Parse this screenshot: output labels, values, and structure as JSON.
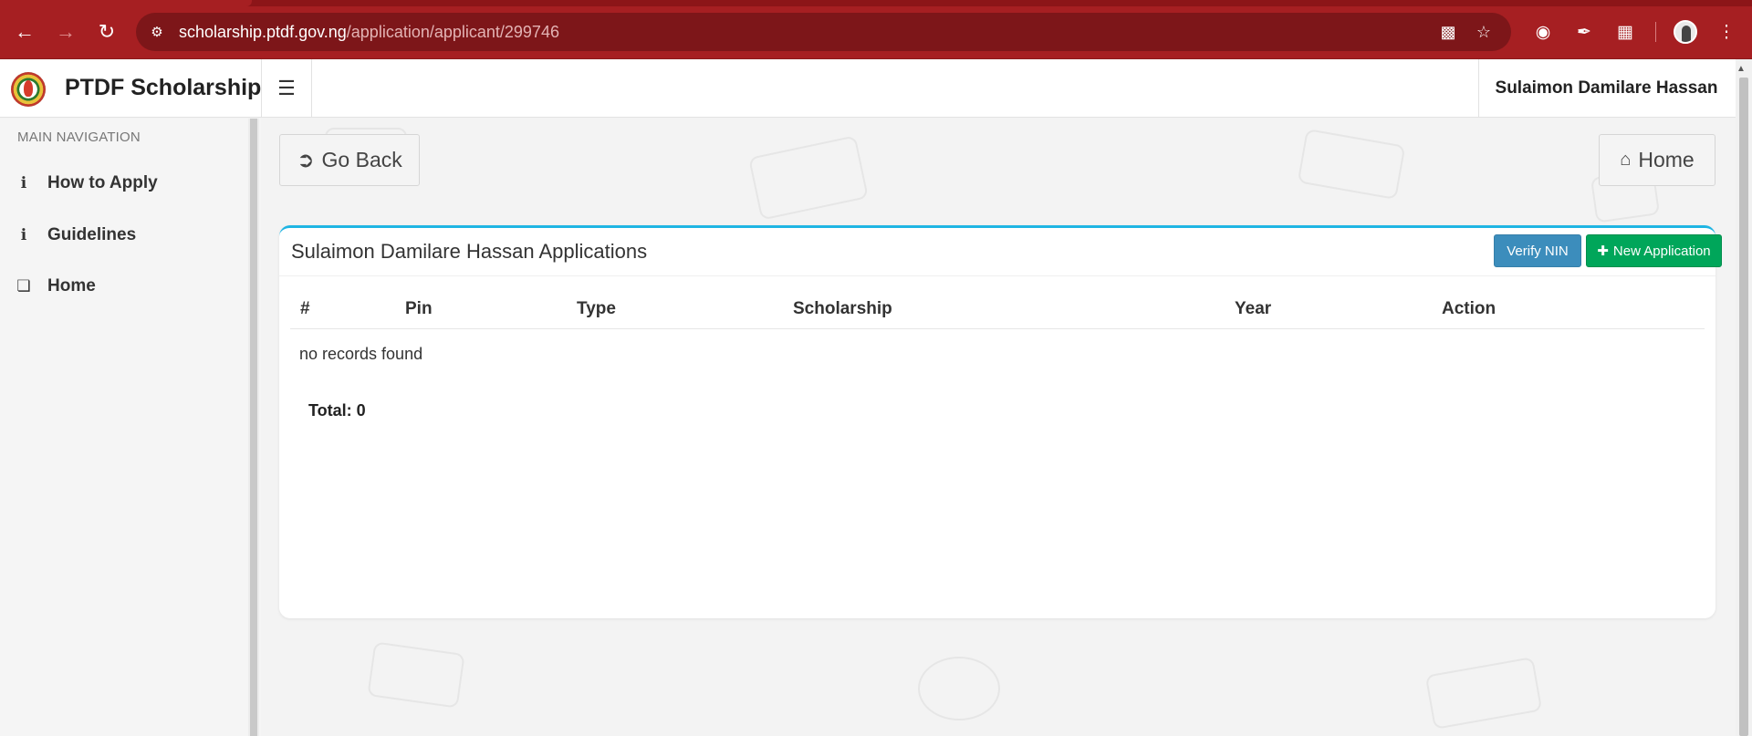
{
  "browser": {
    "url_host": "scholarship.ptdf.gov.ng",
    "url_path": "/application/applicant/299746",
    "icons": {
      "back": "arrow-left-icon",
      "forward": "arrow-right-icon",
      "reload": "reload-icon",
      "site_info": "site-info-icon",
      "install": "install-app-icon",
      "bookmark": "star-icon",
      "ext1": "cookie-icon",
      "ext2": "eyedropper-icon",
      "ext3": "puzzle-icon",
      "menu": "kebab-menu-icon"
    }
  },
  "header": {
    "brand_title": "PTDF Scholarship",
    "user_name": "Sulaimon Damilare Hassan"
  },
  "sidebar": {
    "section_label": "MAIN NAVIGATION",
    "items": [
      {
        "label": "How to Apply",
        "icon": "info-icon"
      },
      {
        "label": "Guidelines",
        "icon": "info-icon"
      },
      {
        "label": "Home",
        "icon": "cube-icon"
      }
    ]
  },
  "main": {
    "go_back_label": "Go Back",
    "home_label": "Home",
    "box": {
      "title": "Sulaimon Damilare Hassan Applications",
      "verify_label": "Verify NIN",
      "new_label": "New Application"
    },
    "table": {
      "columns": [
        "#",
        "Pin",
        "Type",
        "Scholarship",
        "Year",
        "Action"
      ],
      "empty_text": "no records found",
      "total_label": "Total: 0"
    }
  },
  "colors": {
    "browser_bar": "#a61f22",
    "box_accent": "#1fb5e3",
    "verify_btn": "#3c8dbc",
    "new_btn": "#00a65a"
  }
}
